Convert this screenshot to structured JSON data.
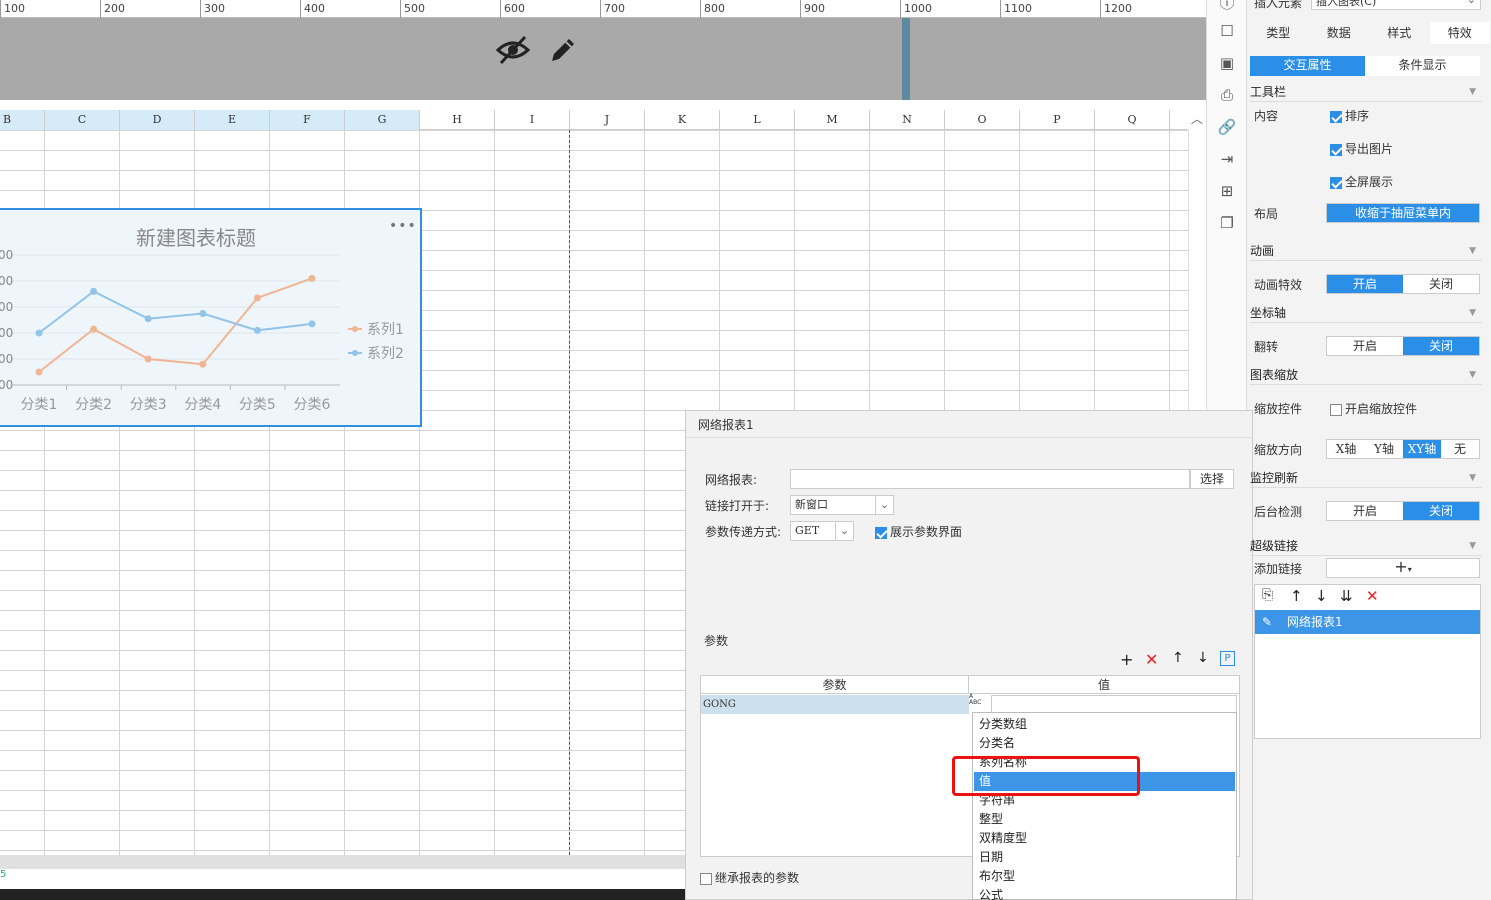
{
  "ruler": {
    "ticks": [
      "100",
      "200",
      "300",
      "400",
      "500",
      "600",
      "700",
      "800",
      "900",
      "1000",
      "1100",
      "1200"
    ]
  },
  "columns": [
    "B",
    "C",
    "D",
    "E",
    "F",
    "G",
    "H",
    "I",
    "J",
    "K",
    "L",
    "M",
    "N",
    "O",
    "P",
    "Q"
  ],
  "chart_data": {
    "type": "line",
    "title": "新建图表标题",
    "categories": [
      "分类1",
      "分类2",
      "分类3",
      "分类4",
      "分类5",
      "分类6"
    ],
    "series": [
      {
        "name": "系列1",
        "values": [
          10,
          43,
          20,
          16,
          67,
          82
        ],
        "color": "#f0b592"
      },
      {
        "name": "系列2",
        "values": [
          40,
          72,
          51,
          55,
          42,
          47
        ],
        "color": "#92c4e8"
      }
    ],
    "y_tick_labels": [
      "00",
      "00",
      "00",
      "00",
      "00",
      "00"
    ],
    "ylim": [
      0,
      100
    ],
    "legend": "right",
    "grid": true
  },
  "chart_more": "•••",
  "status_text": "5",
  "right_panel": {
    "insert_label": "插入元素",
    "insert_value": "插入图表(C)",
    "tabs": [
      "类型",
      "数据",
      "样式",
      "特效"
    ],
    "active_tab": 3,
    "subtabs": [
      "交互属性",
      "条件显示"
    ],
    "toolbar": {
      "title": "工具栏",
      "content_label": "内容",
      "opt_sort": "排序",
      "opt_export": "导出图片",
      "opt_fullscreen": "全屏展示",
      "layout_label": "布局",
      "layout_value": "收缩于抽屉菜单内"
    },
    "animation": {
      "title": "动画",
      "label": "动画特效",
      "on": "开启",
      "off": "关闭"
    },
    "axis": {
      "title": "坐标轴",
      "label": "翻转",
      "on": "开启",
      "off": "关闭"
    },
    "zoom": {
      "title": "图表缩放",
      "control_label": "缩放控件",
      "control_opt": "开启缩放控件",
      "dir_label": "缩放方向",
      "dirs": [
        "X轴",
        "Y轴",
        "XY轴",
        "无"
      ]
    },
    "monitor": {
      "title": "监控刷新",
      "label": "后台检测",
      "on": "开启",
      "off": "关闭"
    },
    "hyperlink": {
      "title": "超级链接",
      "add_label": "添加链接",
      "item": "网络报表1"
    }
  },
  "dialog": {
    "title": "网络报表1",
    "report_label": "网络报表:",
    "select_btn": "选择",
    "open_label": "链接打开于:",
    "open_value": "新窗口",
    "method_label": "参数传递方式:",
    "method_value": "GET",
    "show_params": "展示参数界面",
    "params_title": "参数",
    "col_param": "参数",
    "col_value": "值",
    "row_param": "GONG",
    "inherit": "继承报表的参数",
    "type_icon": "A\nABC",
    "dropdown": [
      "分类数组",
      "分类名",
      "系列名称",
      "值",
      "字符串",
      "整型",
      "双精度型",
      "日期",
      "布尔型",
      "公式"
    ],
    "dropdown_selected": 3
  }
}
